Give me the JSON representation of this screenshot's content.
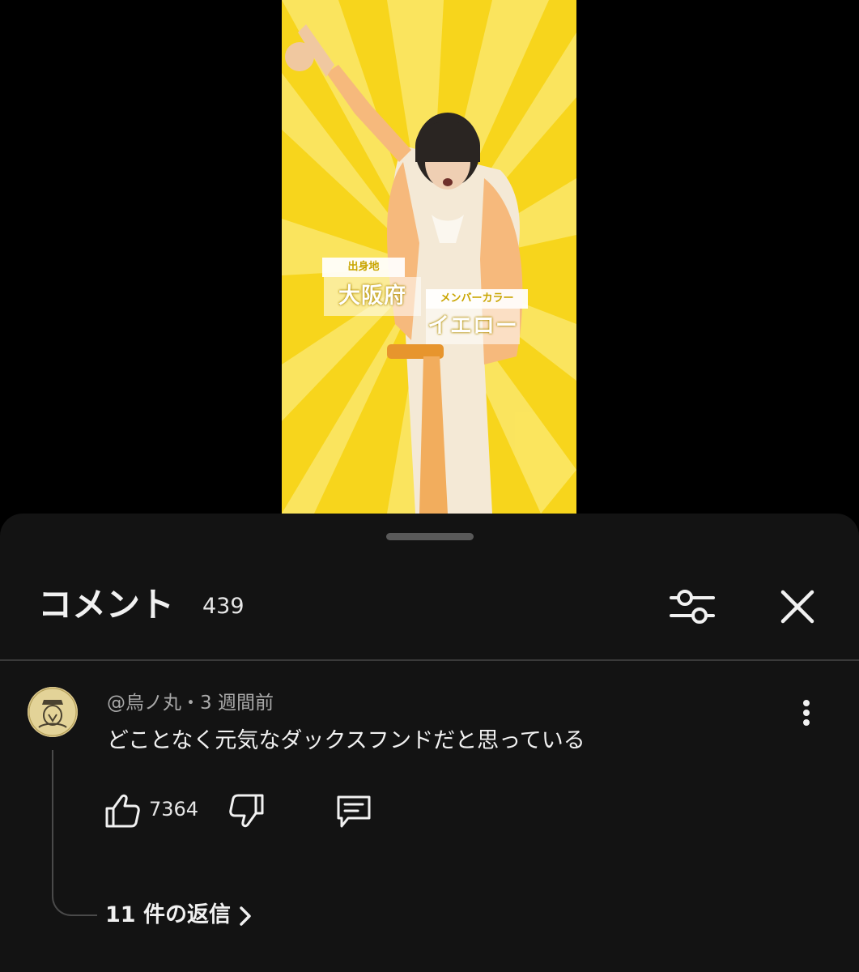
{
  "video": {
    "captions": {
      "origin_label": "出身地",
      "origin_value": "大阪府",
      "color_label": "メンバーカラー",
      "color_value": "イエロー"
    },
    "background_color": "#f5d51a"
  },
  "comments_panel": {
    "title": "コメント",
    "count": "439",
    "filter_icon": "sliders-icon",
    "close_icon": "close-icon"
  },
  "comment": {
    "author": "@烏ノ丸",
    "separator": "・",
    "time": "3 週間前",
    "text": "どことなく元気なダックスフンドだと思っている",
    "like_count": "7364",
    "replies_label": "11 件の返信"
  },
  "colors": {
    "sheet_background": "#131313",
    "text_primary": "#f1f1f1",
    "text_secondary": "#a9a9a9"
  }
}
